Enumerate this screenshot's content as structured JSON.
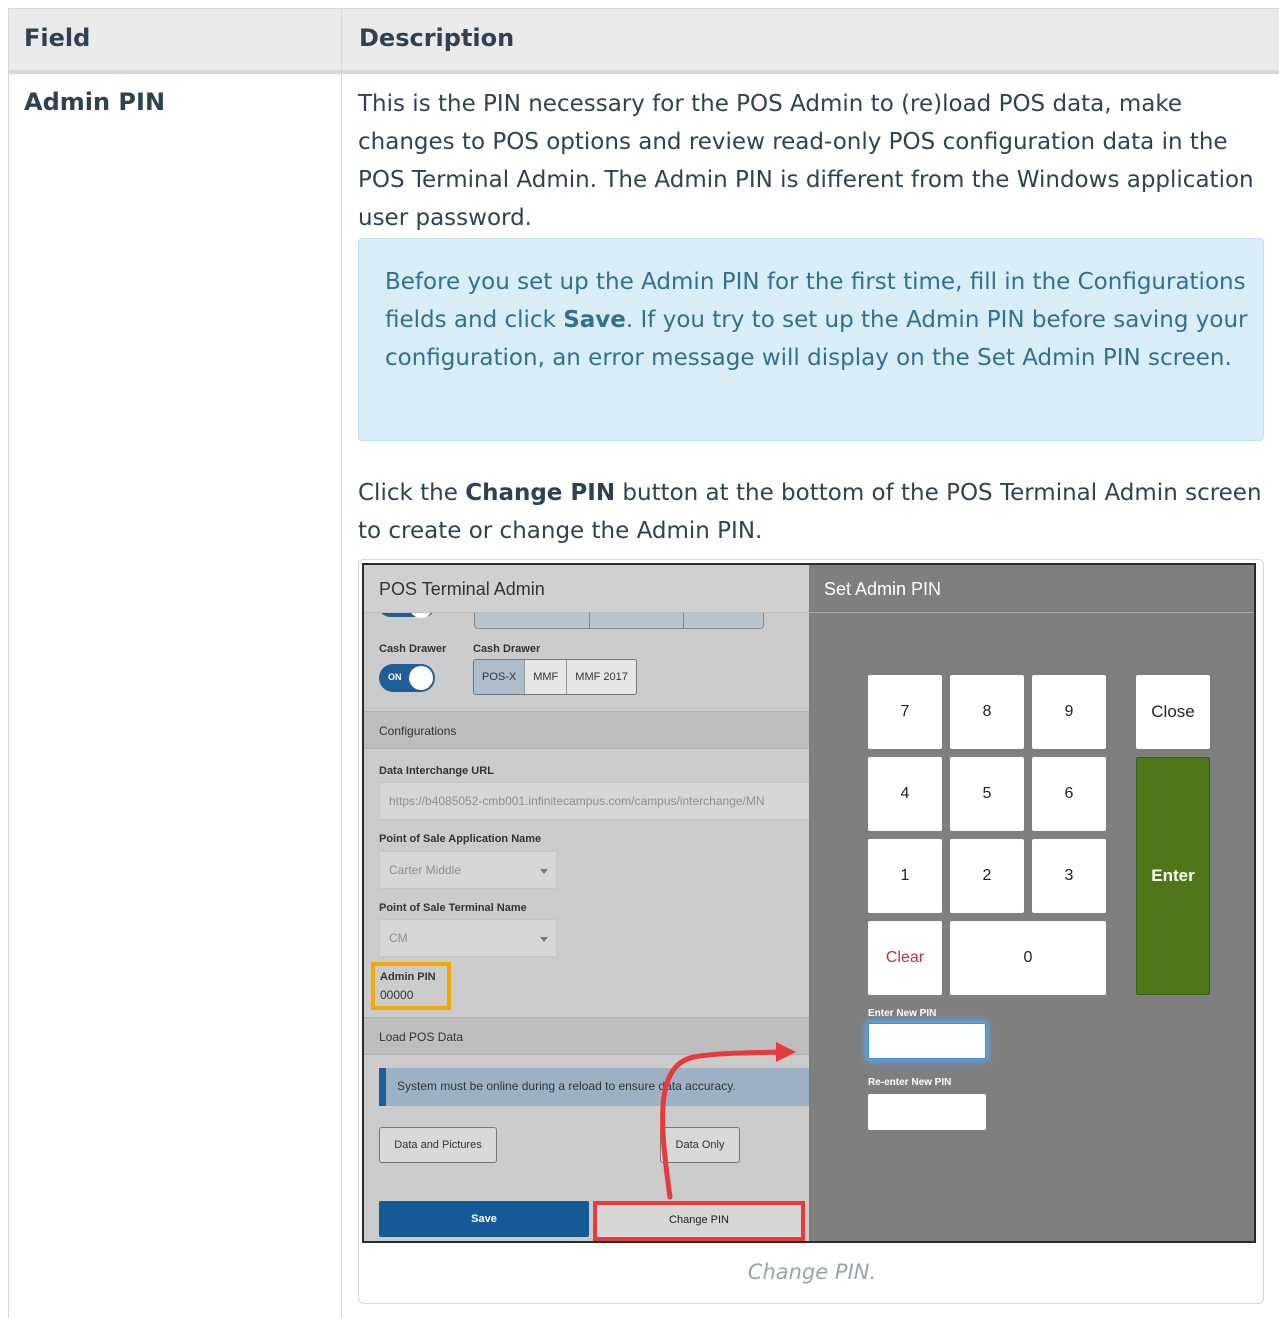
{
  "table": {
    "headers": {
      "field": "Field",
      "description": "Description"
    },
    "row": {
      "field": "Admin PIN",
      "paragraph1": "This is the PIN necessary for the POS Admin to (re)load POS data, make changes to POS options and review read-only POS configuration data in the POS Terminal Admin. The Admin PIN is different from the Windows application user password.",
      "note": {
        "before": "Before you set up the Admin PIN for the first time, fill in the Configurations fields and click ",
        "bold": "Save",
        "after": ". If you try to set up the Admin PIN before saving your configuration, an error message will display on the Set Admin PIN screen."
      },
      "paragraph2": {
        "before": "Click the ",
        "bold": "Change PIN",
        "after": " button at the bottom of the POS Terminal Admin screen to create or change the Admin PIN."
      },
      "caption": "Change PIN."
    }
  },
  "screenshot": {
    "left_title": "POS Terminal Admin",
    "right_title": "Set Admin PIN",
    "cash_drawer_label": "Cash Drawer",
    "cash_drawer_options_label": "Cash Drawer",
    "toggle_on_label": "ON",
    "cash_drawer_options": [
      "POS-X",
      "MMF",
      "MMF 2017"
    ],
    "cash_drawer_selected": "POS-X",
    "configurations_label": "Configurations",
    "data_interchange_label": "Data Interchange URL",
    "data_interchange_value": "https://b4085052-cmb001.infinitecampus.com/campus/interchange/MN",
    "app_name_label": "Point of Sale Application Name",
    "app_name_value": "Carter Middle",
    "terminal_name_label": "Point of Sale Terminal Name",
    "terminal_name_value": "CM",
    "admin_pin_label": "Admin PIN",
    "admin_pin_value": "00000",
    "load_pos_label": "Load POS Data",
    "alert_text": "System must be online during a reload to ensure data accuracy.",
    "btn_data_pictures": "Data and Pictures",
    "btn_data_only": "Data Only",
    "btn_save": "Save",
    "btn_change_pin": "Change PIN",
    "keys": [
      "7",
      "8",
      "9",
      "4",
      "5",
      "6",
      "1",
      "2",
      "3",
      "0"
    ],
    "key_close": "Close",
    "key_enter": "Enter",
    "key_clear": "Clear",
    "enter_pin_label": "Enter New PIN",
    "reenter_pin_label": "Re-enter New PIN",
    "colors": {
      "save_button": "#155a96",
      "enter_key": "#4f7719",
      "admin_pin_highlight": "#f2a800",
      "change_pin_highlight": "#e8393b",
      "clear_key_text": "#d42b2b"
    }
  }
}
